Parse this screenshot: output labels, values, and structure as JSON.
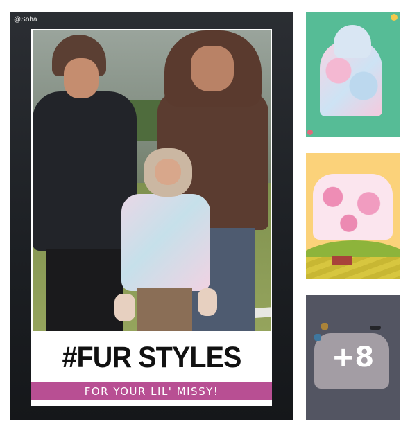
{
  "main_post": {
    "watermark": "@Soha",
    "headline": "#FUR STYLES",
    "subheadline": "FOR YOUR LIL' MISSY!"
  },
  "thumbnails": [
    {
      "background": "#56bc96"
    },
    {
      "background": "#fbd27a"
    },
    {
      "background": "#6a6c7a",
      "more_count": "+8"
    }
  ],
  "colors": {
    "banner": "#b84f93"
  }
}
